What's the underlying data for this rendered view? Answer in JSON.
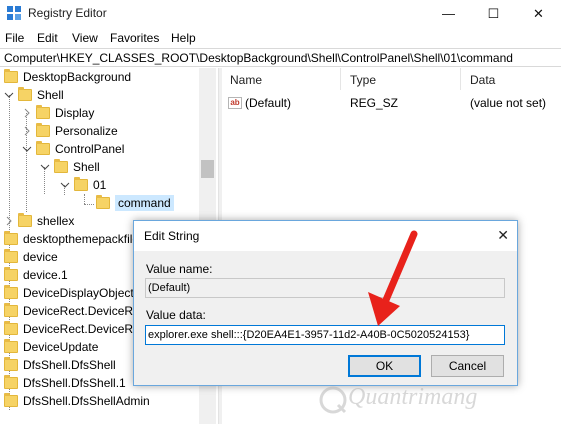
{
  "window": {
    "title": "Registry Editor",
    "minimize": "—",
    "maximize": "☐",
    "close": "✕"
  },
  "menu": [
    "File",
    "Edit",
    "View",
    "Favorites",
    "Help"
  ],
  "address": "Computer\\HKEY_CLASSES_ROOT\\DesktopBackground\\Shell\\ControlPanel\\Shell\\01\\command",
  "tree": {
    "items": [
      {
        "label": "DesktopBackground"
      },
      {
        "label": "Shell"
      },
      {
        "label": "Display"
      },
      {
        "label": "Personalize"
      },
      {
        "label": "ControlPanel"
      },
      {
        "label": "Shell"
      },
      {
        "label": "01"
      },
      {
        "label": "command"
      },
      {
        "label": "shellex"
      },
      {
        "label": "desktopthemepackfile"
      },
      {
        "label": "device"
      },
      {
        "label": "device.1"
      },
      {
        "label": "DeviceDisplayObject"
      },
      {
        "label": "DeviceRect.DeviceRec"
      },
      {
        "label": "DeviceRect.DeviceRec"
      },
      {
        "label": "DeviceUpdate"
      },
      {
        "label": "DfsShell.DfsShell"
      },
      {
        "label": "DfsShell.DfsShell.1"
      },
      {
        "label": "DfsShell.DfsShellAdmin"
      }
    ]
  },
  "list": {
    "columns": [
      "Name",
      "Type",
      "Data"
    ],
    "rows": [
      {
        "name": "(Default)",
        "type": "REG_SZ",
        "data": "(value not set)"
      }
    ]
  },
  "dialog": {
    "title": "Edit String",
    "value_name_label": "Value name:",
    "value_name": "(Default)",
    "value_data_label": "Value data:",
    "value_data": "explorer.exe shell:::{D20EA4E1-3957-11d2-A40B-0C5020524153}",
    "ok_label": "OK",
    "cancel_label": "Cancel"
  },
  "watermark": "Quantrimang",
  "colors": {
    "arrow": "#e8221b",
    "selection": "#cce8ff",
    "accent": "#0078d7"
  }
}
